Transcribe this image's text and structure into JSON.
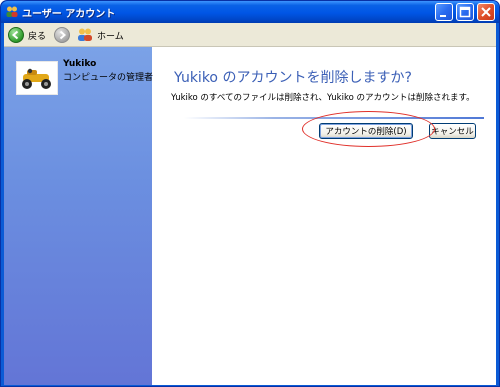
{
  "window": {
    "title": "ユーザー アカウント",
    "controls": [
      "minimize",
      "maximize",
      "close"
    ]
  },
  "toolbar": {
    "back_label": "戻る",
    "home_label": "ホーム"
  },
  "user": {
    "name": "Yukiko",
    "role": "コンピュータの管理者"
  },
  "dialog": {
    "heading": "Yukiko のアカウントを削除しますか?",
    "description": "Yukiko のすべてのファイルは削除され、Yukiko のアカウントは削除されます。",
    "delete_button": "アカウントの削除(D)",
    "cancel_button": "キャンセル"
  },
  "colors": {
    "title_bar": "#0055e5",
    "left_pane": "#6b8fe0",
    "heading": "#3b5fb6",
    "annotation": "#e0302a"
  }
}
